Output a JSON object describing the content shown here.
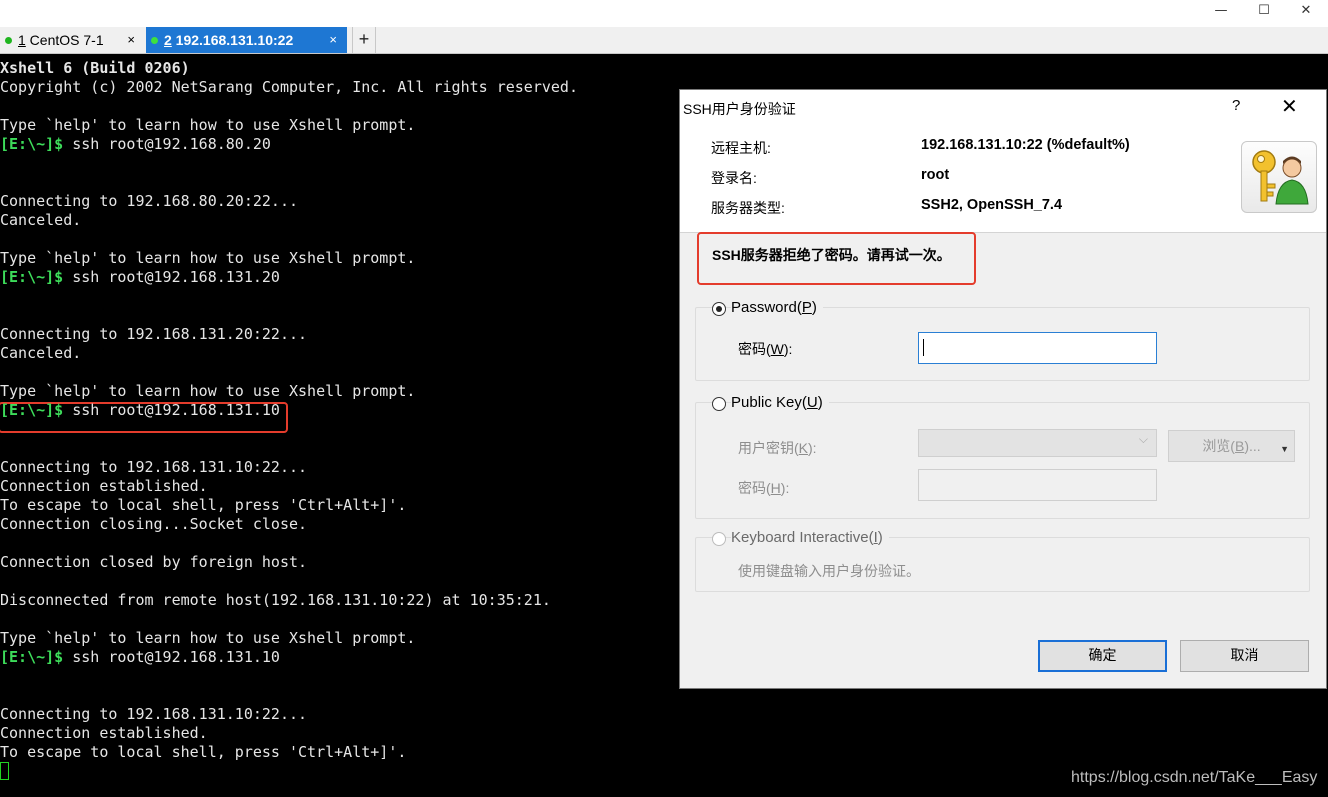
{
  "window": {
    "minimize_icon": "minimize-icon",
    "maximize_icon": "maximize-icon",
    "close_icon": "close-icon",
    "minimize_glyph": "—",
    "maximize_glyph": "☐",
    "close_glyph": "✕"
  },
  "tabs": [
    {
      "num": "1",
      "label": " CentOS 7-1",
      "close": "×",
      "status_color": "#1fb51f"
    },
    {
      "num": "2",
      "label": " 192.168.131.10:22",
      "close": "×",
      "status_color": "#3ee03e",
      "active_color": "#1e77d3"
    }
  ],
  "tab_add": "+",
  "terminal": {
    "prompt": "[E:\\~]$",
    "lines": [
      {
        "text": "Xshell 6 (Build 0206)"
      },
      {
        "text": "Copyright (c) 2002 NetSarang Computer, Inc. All rights reserved."
      },
      {
        "text": ""
      },
      {
        "text": "Type `help' to learn how to use Xshell prompt."
      },
      {
        "cmd": " ssh root@192.168.80.20"
      },
      {
        "text": ""
      },
      {
        "text": ""
      },
      {
        "text": "Connecting to 192.168.80.20:22..."
      },
      {
        "text": "Canceled."
      },
      {
        "text": ""
      },
      {
        "text": "Type `help' to learn how to use Xshell prompt."
      },
      {
        "cmd": " ssh root@192.168.131.20"
      },
      {
        "text": ""
      },
      {
        "text": ""
      },
      {
        "text": "Connecting to 192.168.131.20:22..."
      },
      {
        "text": "Canceled."
      },
      {
        "text": ""
      },
      {
        "text": "Type `help' to learn how to use Xshell prompt."
      },
      {
        "cmd": " ssh root@192.168.131.10"
      },
      {
        "text": ""
      },
      {
        "text": ""
      },
      {
        "text": "Connecting to 192.168.131.10:22..."
      },
      {
        "text": "Connection established."
      },
      {
        "text": "To escape to local shell, press 'Ctrl+Alt+]'."
      },
      {
        "text": "Connection closing...Socket close."
      },
      {
        "text": ""
      },
      {
        "text": "Connection closed by foreign host."
      },
      {
        "text": ""
      },
      {
        "text": "Disconnected from remote host(192.168.131.10:22) at 10:35:21."
      },
      {
        "text": ""
      },
      {
        "text": "Type `help' to learn how to use Xshell prompt."
      },
      {
        "cmd": " ssh root@192.168.131.10"
      },
      {
        "text": ""
      },
      {
        "text": ""
      },
      {
        "text": "Connecting to 192.168.131.10:22..."
      },
      {
        "text": "Connection established."
      },
      {
        "text": "To escape to local shell, press 'Ctrl+Alt+]'."
      }
    ]
  },
  "dialog": {
    "title": "SSH用户身份验证",
    "help": "?",
    "close": "✕",
    "host_label": "远程主机:",
    "host_value": "192.168.131.10:22 (%default%)",
    "user_label": "登录名:",
    "user_value": "root",
    "server_label": "服务器类型:",
    "server_value": "SSH2, OpenSSH_7.4",
    "error": "SSH服务器拒绝了密码。请再试一次。",
    "password_option": {
      "text": "Password(",
      "key": "P",
      "end": ")"
    },
    "password_field": {
      "text": "密码(",
      "key": "W",
      "end": "):"
    },
    "password_value": "",
    "pubkey_option": {
      "text": "Public Key(",
      "key": "U",
      "end": ")"
    },
    "user_key": {
      "text": "用户密钥(",
      "key": "K",
      "end": "):"
    },
    "browse": {
      "text": "浏览(",
      "key": "B",
      "end": ")..."
    },
    "passphrase": {
      "text": "密码(",
      "key": "H",
      "end": "):"
    },
    "kbd_option": {
      "text": "Keyboard Interactive(",
      "key": "I",
      "end": ")"
    },
    "kbd_desc": "使用键盘输入用户身份验证。",
    "ok": "确定",
    "cancel": "取消",
    "highlight_color": "#e43c2c"
  },
  "watermark": "https://blog.csdn.net/TaKe___Easy"
}
